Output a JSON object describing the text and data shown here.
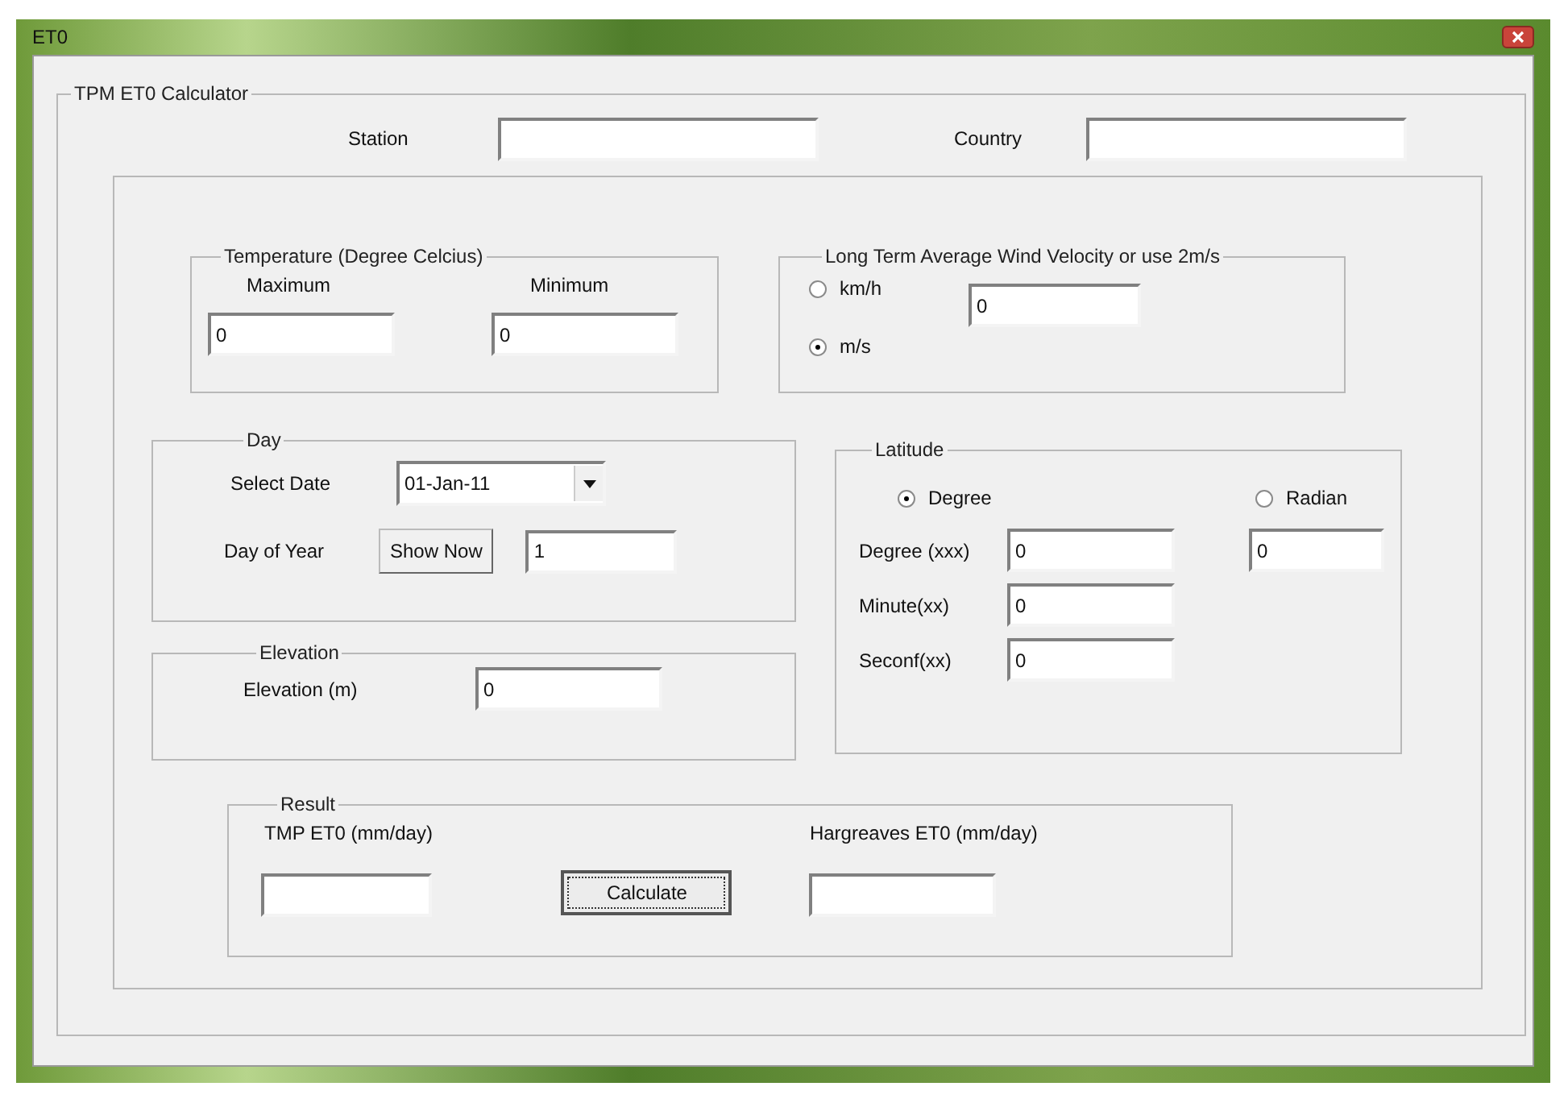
{
  "window": {
    "title": "ET0"
  },
  "calculator": {
    "title": "TPM ET0 Calculator",
    "station": {
      "label": "Station"
    },
    "country": {
      "label": "Country"
    }
  },
  "temperature": {
    "title": "Temperature (Degree Celcius)",
    "fields": [
      {
        "label": "Maximum",
        "value": "0"
      },
      {
        "label": "Minimum",
        "value": "0"
      }
    ]
  },
  "wind": {
    "title": "Long Term Average Wind Velocity or use 2m/s",
    "units": [
      {
        "label": "km/h",
        "selected": false
      },
      {
        "label": "m/s",
        "selected": true
      }
    ],
    "value": "0"
  },
  "day": {
    "title": "Day",
    "select_date": {
      "label": "Select Date",
      "value": "01-Jan-11"
    },
    "day_of_year": {
      "label": "Day of Year",
      "button": "Show Now",
      "value": "1"
    }
  },
  "elevation": {
    "title": "Elevation",
    "label": "Elevation (m)",
    "value": "0"
  },
  "latitude": {
    "title": "Latitude",
    "modes": [
      {
        "label": "Degree",
        "selected": true
      },
      {
        "label": "Radian",
        "selected": false
      }
    ],
    "radian_value": "0",
    "fields": [
      {
        "label": "Degree (xxx)",
        "value": "0"
      },
      {
        "label": "Minute(xx)",
        "value": "0"
      },
      {
        "label": "Seconf(xx)",
        "value": "0"
      }
    ]
  },
  "result": {
    "title": "Result",
    "outputs": [
      {
        "label": "TMP ET0 (mm/day)"
      },
      {
        "label": "Hargreaves ET0 (mm/day)"
      }
    ],
    "button": "Calculate"
  }
}
